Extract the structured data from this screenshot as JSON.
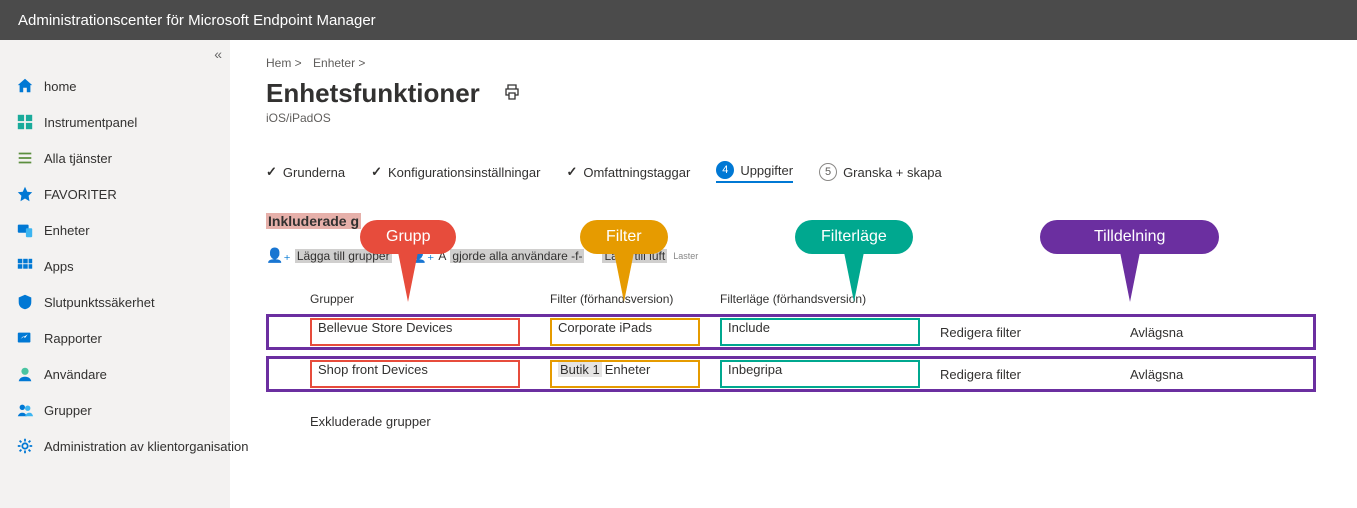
{
  "app_title": "Administrationscenter för Microsoft Endpoint Manager",
  "sidebar": {
    "items": [
      {
        "label": "home"
      },
      {
        "label": "Instrumentpanel"
      },
      {
        "label": "Alla tjänster"
      },
      {
        "label": "FAVORITER"
      },
      {
        "label": "Enheter"
      },
      {
        "label": "Apps"
      },
      {
        "label": "Slutpunktssäkerhet"
      },
      {
        "label": "Rapporter"
      },
      {
        "label": "Användare"
      },
      {
        "label": "Grupper"
      },
      {
        "label": "Administration av klientorganisation"
      }
    ]
  },
  "breadcrumb": {
    "a": "Hem >",
    "b": "Enheter >"
  },
  "page": {
    "title": "Enhetsfunktioner",
    "subtitle": "iOS/iPadOS"
  },
  "steps": {
    "s1": "Grunderna",
    "s2": "Konfigurationsinställningar",
    "s3": "Omfattningstaggar",
    "s4num": "4",
    "s4": "Uppgifter",
    "s5num": "5",
    "s5": "Granska + skapa"
  },
  "sections": {
    "included": "Inkluderade g",
    "excluded": "Exkluderade grupper"
  },
  "addbar": {
    "b1a": "Lägga till grupper",
    "b2a": "A",
    "b2b": "gjorde alla användare -f-",
    "b3a": "Lägg till luft",
    "b3b": "Laster"
  },
  "cols": {
    "group": "Grupper",
    "filter": "Filter (förhandsversion)",
    "mode": "Filterläge (förhandsversion)"
  },
  "rows": [
    {
      "group": "Bellevue Store Devices",
      "filter": "Corporate iPads",
      "filter_pre": "",
      "mode": "Include",
      "edit": "Redigera filter",
      "remove": "Avlägsna"
    },
    {
      "group": "Shop front Devices",
      "filter": "Enheter",
      "filter_pre": "Butik 1",
      "mode": "Inbegripa",
      "edit": "Redigera filter",
      "remove": "Avlägsna"
    }
  ],
  "callouts": {
    "group": "Grupp",
    "filter": "Filter",
    "mode": "Filterläge",
    "assign": "Tilldelning"
  }
}
